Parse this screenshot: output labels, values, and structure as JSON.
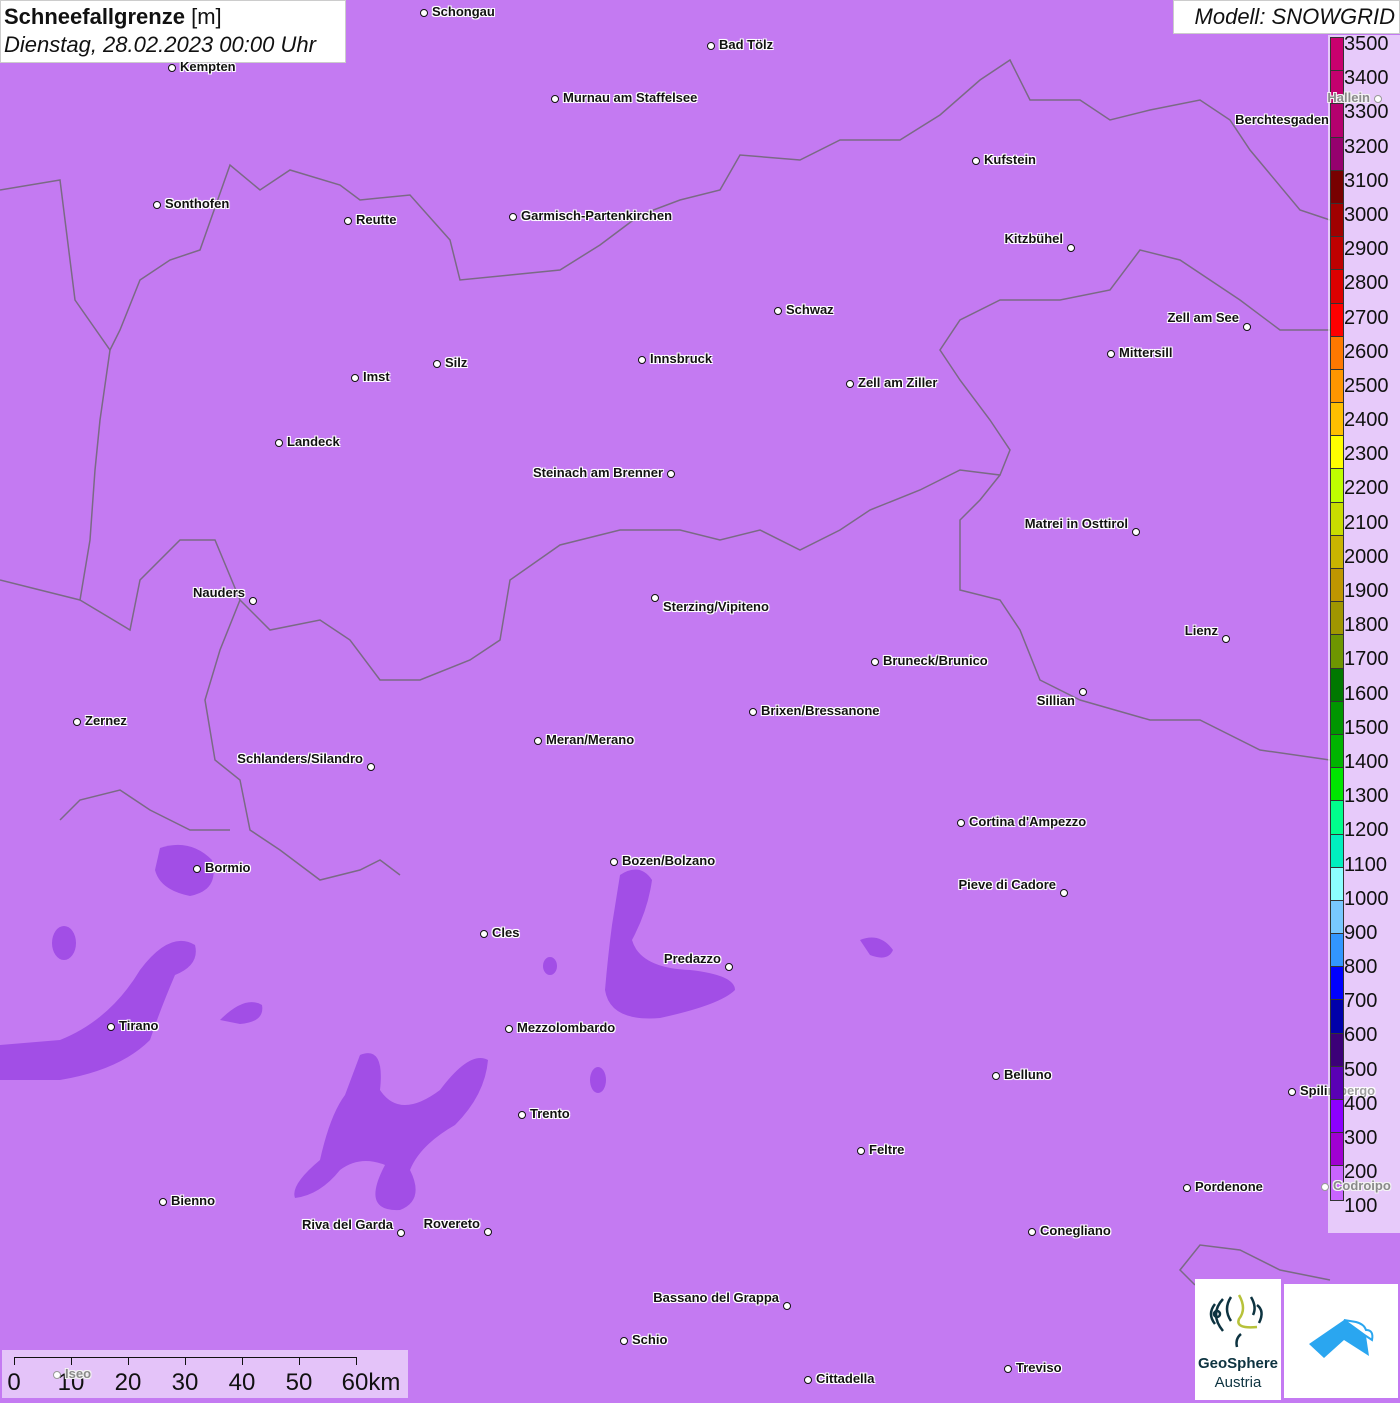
{
  "header": {
    "title": "Schneefallgrenze",
    "unit": "[m]",
    "datetime": "Dienstag, 28.02.2023 00:00 Uhr",
    "model": "Modell: SNOWGRID"
  },
  "legend": {
    "labels": [
      "3500",
      "3400",
      "3300",
      "3200",
      "3100",
      "3000",
      "2900",
      "2800",
      "2700",
      "2600",
      "2500",
      "2400",
      "2300",
      "2200",
      "2100",
      "2000",
      "1900",
      "1800",
      "1700",
      "1600",
      "1500",
      "1400",
      "1300",
      "1200",
      "1100",
      "1000",
      "900",
      "800",
      "700",
      "600",
      "500",
      "400",
      "300",
      "200",
      "100"
    ],
    "colors": [
      "#c8006e",
      "#c4006e",
      "#b4006e",
      "#96006e",
      "#780000",
      "#a00000",
      "#be0000",
      "#dc0000",
      "#ff0000",
      "#ff7800",
      "#ff9600",
      "#ffbe00",
      "#ffff00",
      "#beff00",
      "#c8dc00",
      "#c8b400",
      "#be9600",
      "#a09600",
      "#6e9600",
      "#007800",
      "#009600",
      "#00b400",
      "#00e600",
      "#00ff8c",
      "#00f0be",
      "#8cffff",
      "#78c8ff",
      "#3296ff",
      "#0000ff",
      "#0000aa",
      "#3c0078",
      "#5a00b4",
      "#8c00ff",
      "#a000d2",
      "#c864ff"
    ]
  },
  "scale_bar": {
    "labels": [
      "0",
      "10",
      "20",
      "30",
      "40",
      "50",
      "60km"
    ]
  },
  "logos": {
    "geosphere_line1": "GeoSphere",
    "geosphere_line2": "Austria"
  },
  "colors": {
    "map_background": "#c47af2",
    "low_snowline": "#a24ee6",
    "border": "#7a6a85"
  },
  "cities": [
    "Schongau",
    "Bad Tölz",
    "Kempten",
    "Murnau am Staffelsee",
    "Kufstein",
    "Hallein",
    "Berchtesgaden",
    "Sonthofen",
    "Reutte",
    "Garmisch-Partenkirchen",
    "Kitzbühel",
    "Schwaz",
    "Zell am See",
    "Mittersill",
    "Innsbruck",
    "Silz",
    "Imst",
    "Zell am Ziller",
    "Landeck",
    "Steinach am Brenner",
    "Matrei in Osttirol",
    "Nauders",
    "Sterzing/Vipiteno",
    "Lienz",
    "Bruneck/Brunico",
    "Sillian",
    "Brixen/Bressanone",
    "Zernez",
    "Meran/Merano",
    "Schlanders/Silandro",
    "Cortina d'Ampezzo",
    "Bozen/Bolzano",
    "Bormio",
    "Pieve di Cadore",
    "Cles",
    "Predazzo",
    "Tirano",
    "Mezzolombardo",
    "Belluno",
    "Spilimbergo",
    "Trento",
    "Feltre",
    "Pordenone",
    "Codroipo",
    "Bienno",
    "Riva del Garda",
    "Rovereto",
    "Conegliano",
    "Bassano del Grappa",
    "Schio",
    "Treviso",
    "Cittadella",
    "Iseo"
  ]
}
